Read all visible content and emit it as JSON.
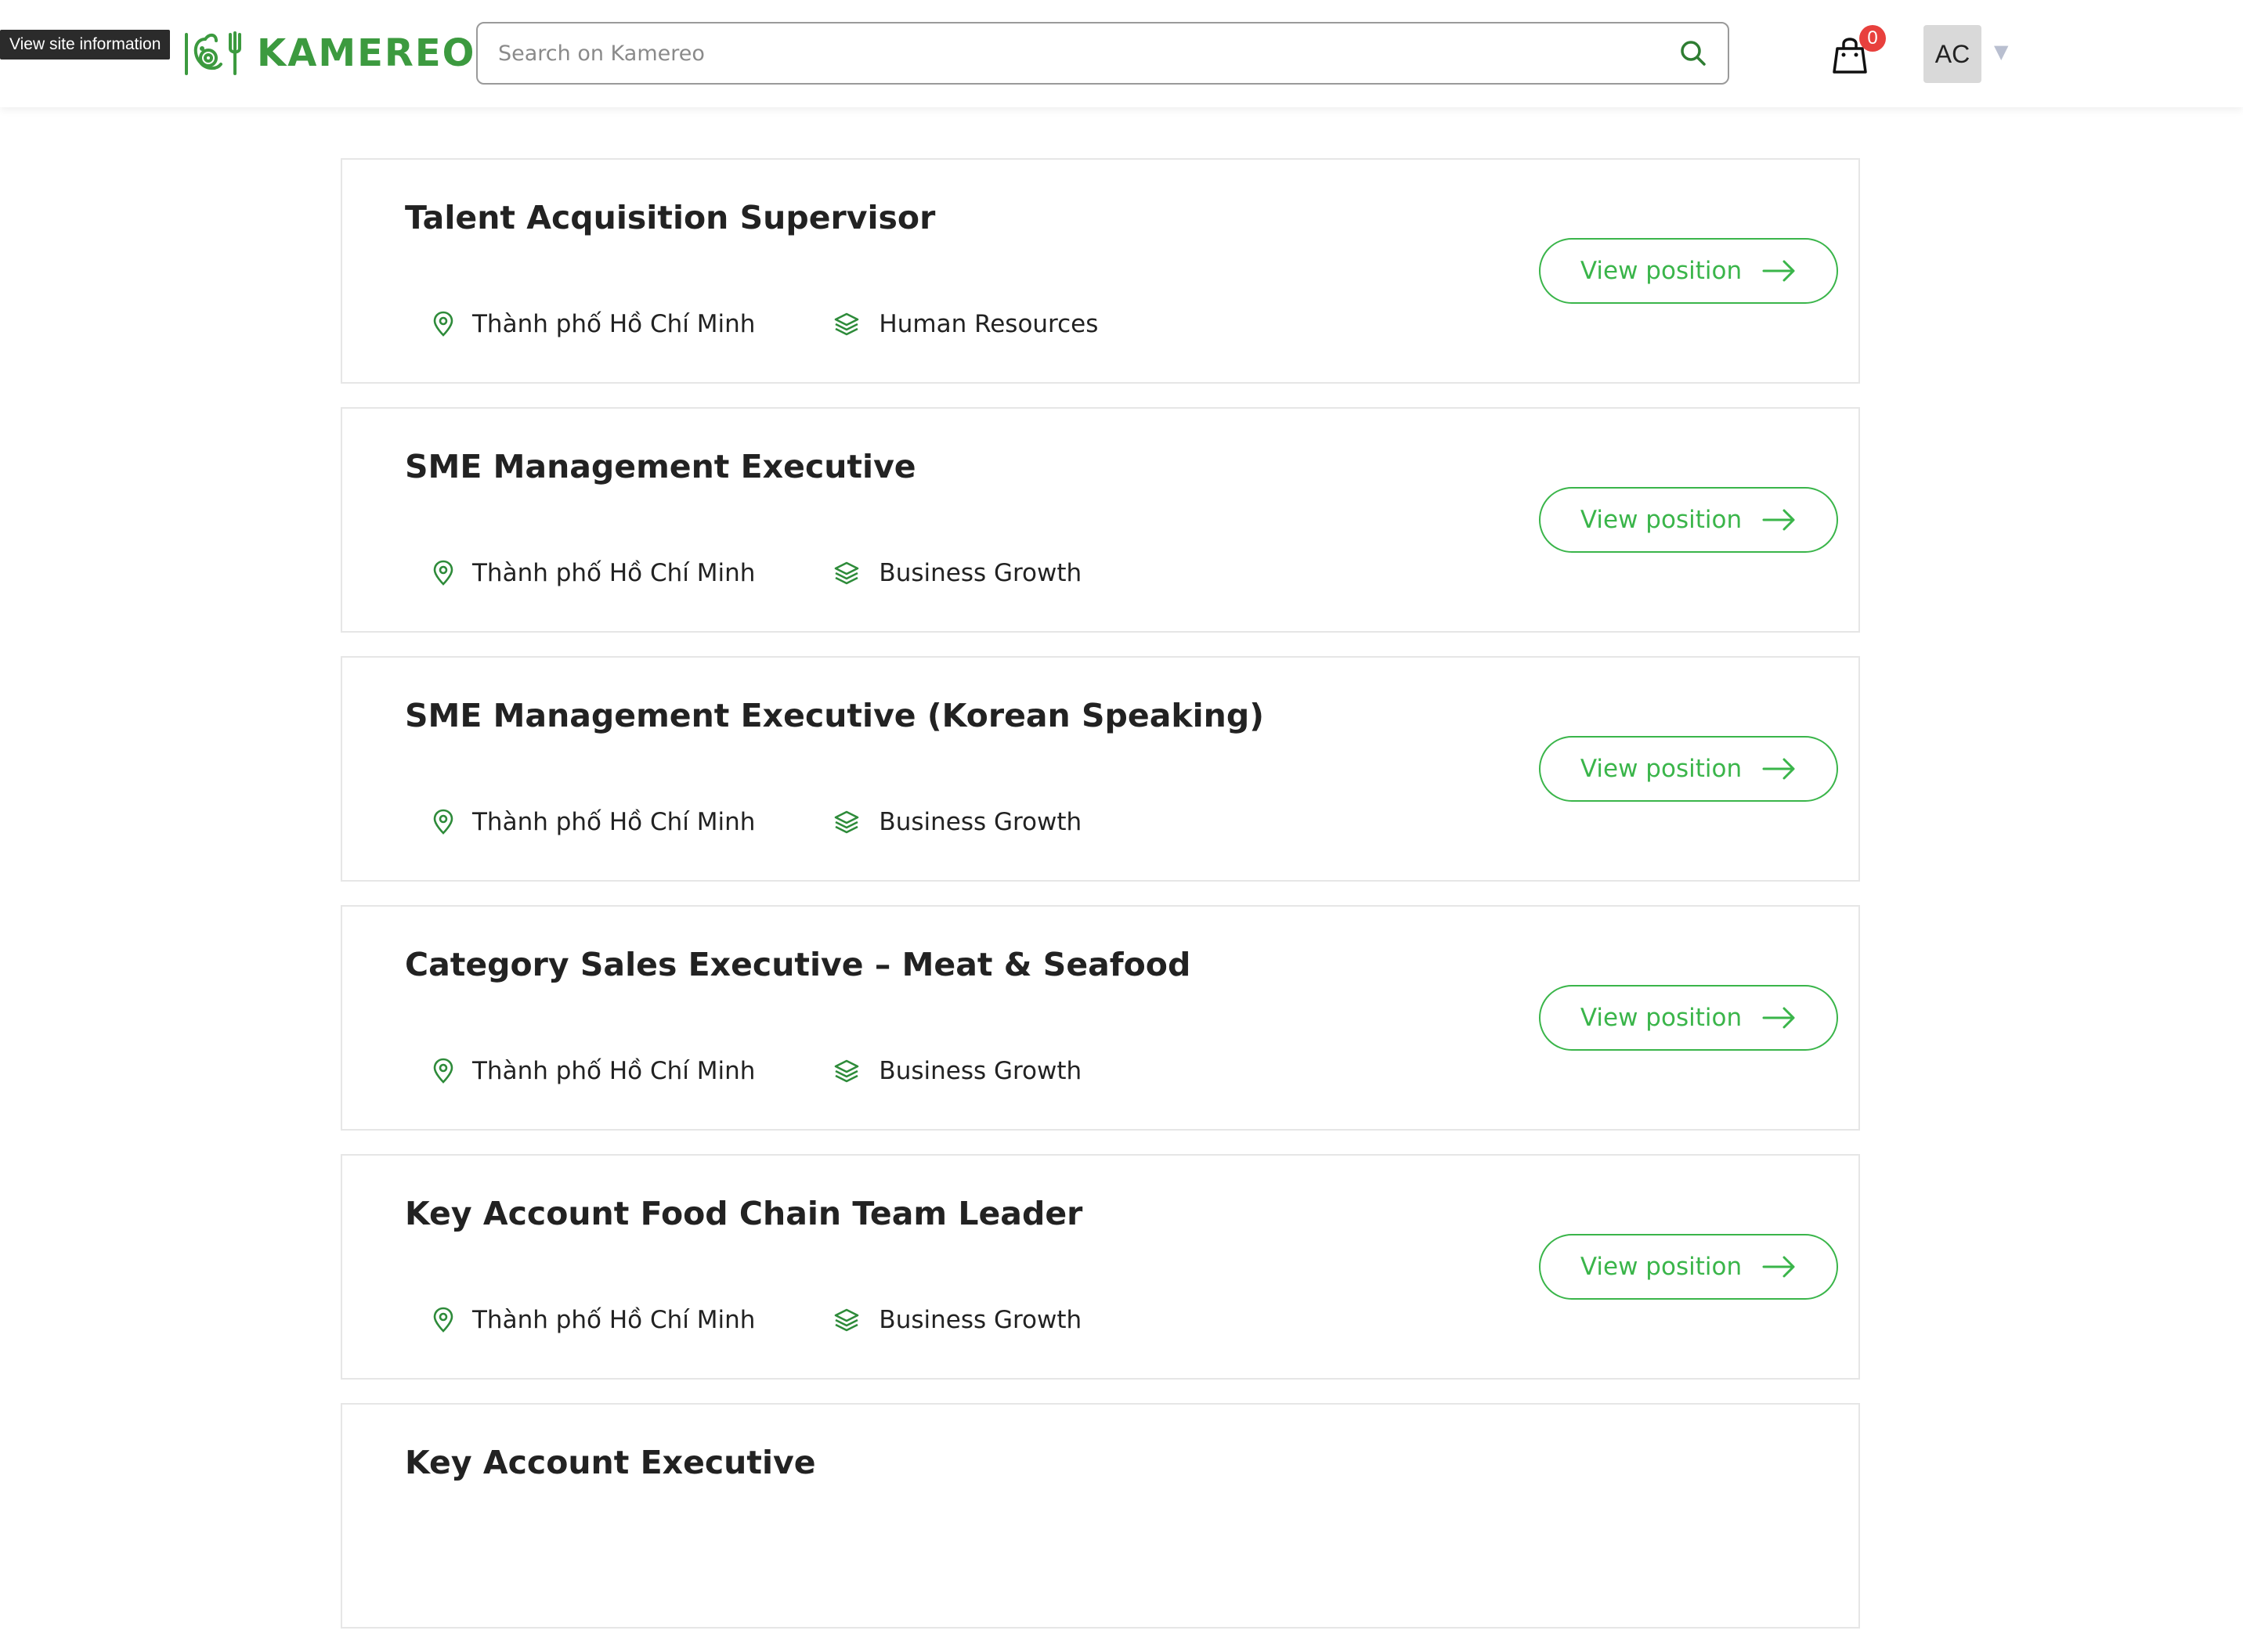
{
  "browser": {
    "tooltip": "View site information"
  },
  "header": {
    "brand": "KAMEREO",
    "search_placeholder": "Search on Kamereo",
    "cart_count": "0",
    "avatar_initials": "AC",
    "icons": {
      "search": "search-icon",
      "cart": "shopping-bag-icon",
      "dropdown": "chevron-down-icon"
    }
  },
  "colors": {
    "brand_green": "#3c9a3f",
    "button_green": "#3ab54a",
    "badge_red": "#e8403d"
  },
  "jobs": [
    {
      "title": "Talent Acquisition Supervisor",
      "location": "Thành phố Hồ Chí Minh",
      "department": "Human Resources",
      "cta": "View position"
    },
    {
      "title": "SME Management Executive",
      "location": "Thành phố Hồ Chí Minh",
      "department": "Business Growth",
      "cta": "View position"
    },
    {
      "title": "SME Management Executive (Korean Speaking)",
      "location": "Thành phố Hồ Chí Minh",
      "department": "Business Growth",
      "cta": "View position"
    },
    {
      "title": "Category Sales Executive – Meat & Seafood",
      "location": "Thành phố Hồ Chí Minh",
      "department": "Business Growth",
      "cta": "View position"
    },
    {
      "title": "Key Account Food Chain Team Leader",
      "location": "Thành phố Hồ Chí Minh",
      "department": "Business Growth",
      "cta": "View position"
    },
    {
      "title": "Key Account Executive"
    }
  ]
}
